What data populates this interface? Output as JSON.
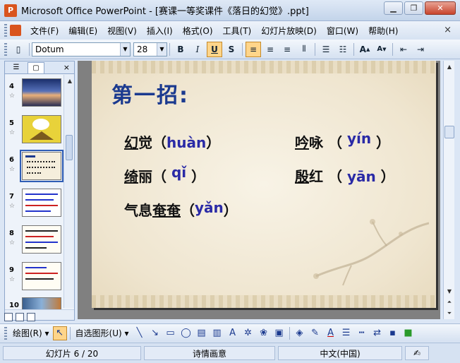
{
  "window": {
    "title": "Microsoft Office PowerPoint - [赛课一等奖课件《落日的幻觉》.ppt]",
    "app_icon": "P",
    "controls": [
      "minimize-icon",
      "restore-icon",
      "close-icon"
    ]
  },
  "menubar": {
    "items": [
      "文件(F)",
      "编辑(E)",
      "视图(V)",
      "插入(I)",
      "格式(O)",
      "工具(T)",
      "幻灯片放映(D)",
      "窗口(W)",
      "帮助(H)"
    ],
    "close": "×"
  },
  "toolbar": {
    "font": "Dotum",
    "size": "28",
    "bold": "B",
    "italic": "I",
    "underline": "U",
    "shadow": "S",
    "active_color": "#ffd58a"
  },
  "slides_panel": {
    "numbers": [
      "4",
      "5",
      "6",
      "7",
      "8",
      "9",
      "10"
    ],
    "selected": "6",
    "close": "×"
  },
  "slide": {
    "title": "第一招:",
    "items": [
      {
        "pre": "",
        "u": "幻",
        "post": "觉（",
        "pinyin": "huàn",
        "end": "）"
      },
      {
        "pre": "",
        "u": "吟",
        "post": "咏  （ ",
        "pinyin": "yín",
        "end": " ）"
      },
      {
        "pre": "",
        "u": "绮",
        "post": "丽（ ",
        "pinyin": "qǐ",
        "end": " ）"
      },
      {
        "pre": "",
        "u": "殷",
        "post": "红  （ ",
        "pinyin": "yān",
        "end": " ）"
      },
      {
        "pre": "气息",
        "u": "奄奄",
        "post": "（",
        "pinyin": "yǎn",
        "end": "）"
      }
    ],
    "title_color": "#1b3a8f",
    "pinyin_color": "#2a2aa6"
  },
  "drawbar": {
    "draw_label": "绘图(R)",
    "autoshape_label": "自选图形(U)"
  },
  "status": {
    "slide_pos": "幻灯片 6 / 20",
    "theme": "诗情画意",
    "language": "中文(中国)"
  }
}
